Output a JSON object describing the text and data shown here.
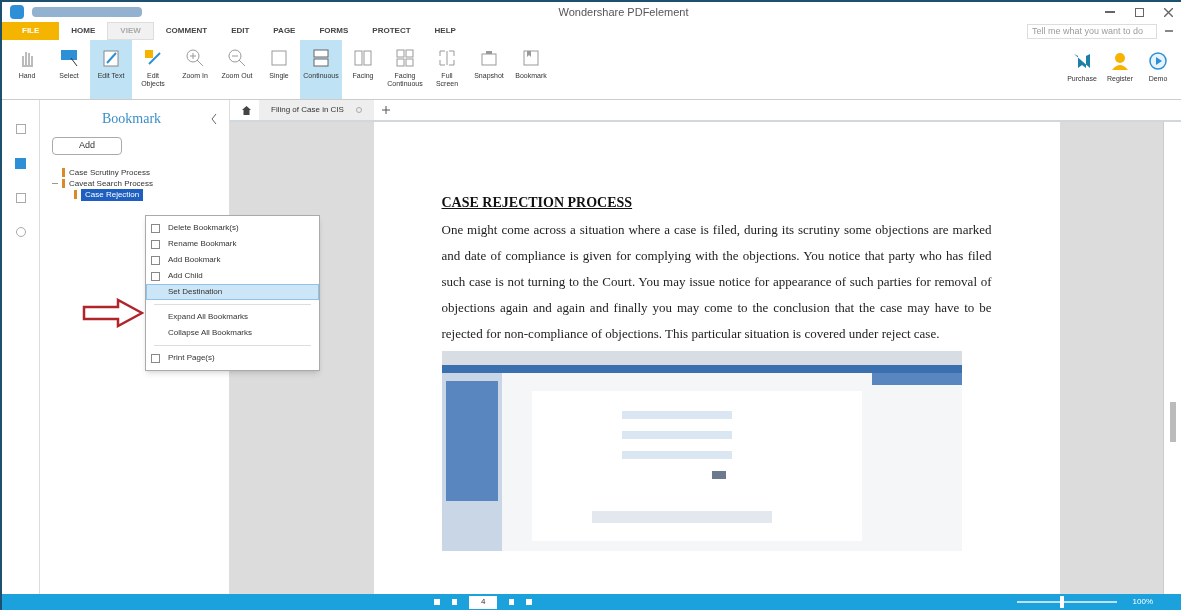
{
  "window": {
    "title": "Wondershare PDFelement"
  },
  "file_button": {
    "label": "FILE"
  },
  "menu_tabs": [
    {
      "label": "HOME",
      "selected": false
    },
    {
      "label": "VIEW",
      "selected": true
    },
    {
      "label": "COMMENT",
      "selected": false
    },
    {
      "label": "EDIT",
      "selected": false
    },
    {
      "label": "PAGE",
      "selected": false
    },
    {
      "label": "FORMS",
      "selected": false
    },
    {
      "label": "PROTECT",
      "selected": false
    },
    {
      "label": "HELP",
      "selected": false
    }
  ],
  "search": {
    "placeholder": "Tell me what you want to do"
  },
  "ribbon": [
    {
      "label": "Hand",
      "selected": false
    },
    {
      "label": "Select",
      "selected": false
    },
    {
      "label": "Edit Text",
      "selected": true
    },
    {
      "label": "Edit Objects",
      "selected": false
    },
    {
      "label": "Zoom In",
      "selected": false
    },
    {
      "label": "Zoom Out",
      "selected": false
    },
    {
      "label": "Single",
      "selected": false
    },
    {
      "label": "Continuous",
      "selected": true
    },
    {
      "label": "Facing",
      "selected": false
    },
    {
      "label": "Facing Continuous",
      "selected": false
    },
    {
      "label": "Full Screen",
      "selected": false
    },
    {
      "label": "Snapshot",
      "selected": false
    },
    {
      "label": "Bookmark",
      "selected": false
    }
  ],
  "ribbon_right": [
    {
      "label": "Purchase"
    },
    {
      "label": "Register"
    },
    {
      "label": "Demo"
    }
  ],
  "bookmark_panel": {
    "title": "Bookmark",
    "add_button": "Add",
    "items": [
      {
        "label": "Case Scrutiny Process",
        "selected": false
      },
      {
        "label": "Caveat Search Process",
        "selected": false,
        "expanded": true,
        "children": [
          {
            "label": "Case Rejection",
            "selected": true
          }
        ]
      }
    ]
  },
  "context_menu": [
    {
      "label": "Delete Bookmark(s)",
      "selected": false
    },
    {
      "label": "Rename Bookmark",
      "selected": false
    },
    {
      "label": "Add Bookmark",
      "selected": false
    },
    {
      "label": "Add Child",
      "selected": false
    },
    {
      "label": "Set Destination",
      "selected": true
    },
    {
      "label": "Expand All Bookmarks",
      "selected": false
    },
    {
      "label": "Collapse All Bookmarks",
      "selected": false
    },
    {
      "label": "Print Page(s)",
      "selected": false
    }
  ],
  "doc_tab": {
    "label": "Filing of Case in CIS"
  },
  "document": {
    "heading": "CASE REJECTION PROCESS",
    "body": "One might come across a situation where a case is filed, during its scrutiny some objections are marked and date of compliance is given for complying with the objections. You notice that party who has filed such case is not turning to the Court. You may issue notice for appearance of such parties for removal of objections again and again and finally you may come to the conclusion that the case may have to be rejected for non-compliance of objections. This particular situation is covered under reject case."
  },
  "status_bar": {
    "page": "4",
    "zoom": "100%",
    "zoom_slider": {
      "level": 0.45
    }
  }
}
